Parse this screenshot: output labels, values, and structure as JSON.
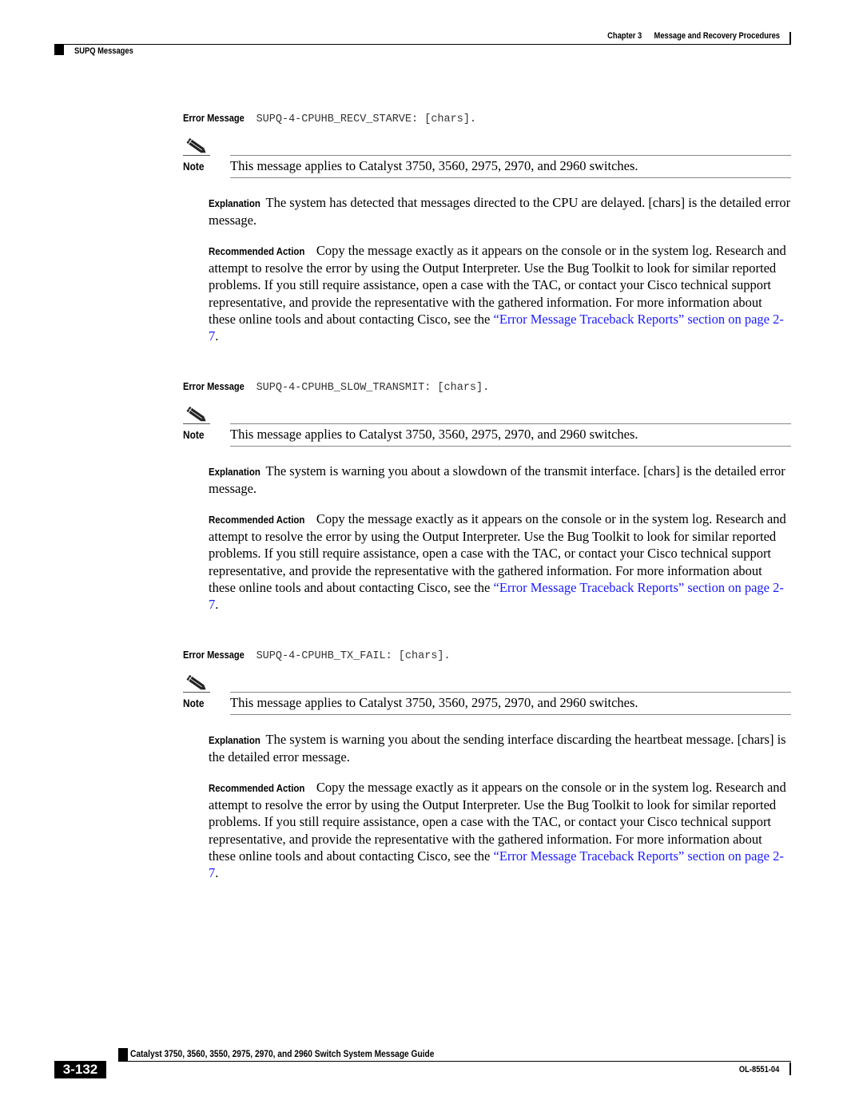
{
  "header": {
    "chapter_label": "Chapter 3",
    "chapter_title": "Message and Recovery Procedures",
    "section": "SUPQ Messages"
  },
  "entries": [
    {
      "error_label": "Error Message",
      "error_code": "SUPQ-4-CPUHB_RECV_STARVE: [chars].",
      "note_label": "Note",
      "note_text": "This message applies to Catalyst 3750, 3560, 2975, 2970, and 2960 switches.",
      "explanation_label": "Explanation",
      "explanation_text": "The system has detected that messages directed to the CPU are delayed. [chars] is the detailed error message.",
      "action_label": "Recommended Action",
      "action_text": "Copy the message exactly as it appears on the console or in the system log. Research and attempt to resolve the error by using the Output Interpreter. Use the Bug Toolkit to look for similar reported problems. If you still require assistance, open a case with the TAC, or contact your Cisco technical support representative, and provide the representative with the gathered information. For more information about these online tools and about contacting Cisco, see the ",
      "action_link": "“Error Message Traceback Reports” section on page 2-7",
      "action_end": "."
    },
    {
      "error_label": "Error Message",
      "error_code": "SUPQ-4-CPUHB_SLOW_TRANSMIT: [chars].",
      "note_label": "Note",
      "note_text": "This message applies to Catalyst 3750, 3560, 2975, 2970, and 2960 switches.",
      "explanation_label": "Explanation",
      "explanation_text": "The system is warning you about a slowdown of the transmit interface. [chars] is the detailed error message.",
      "action_label": "Recommended Action",
      "action_text": "Copy the message exactly as it appears on the console or in the system log. Research and attempt to resolve the error by using the Output Interpreter. Use the Bug Toolkit to look for similar reported problems. If you still require assistance, open a case with the TAC, or contact your Cisco technical support representative, and provide the representative with the gathered information. For more information about these online tools and about contacting Cisco, see the ",
      "action_link": "“Error Message Traceback Reports” section on page 2-7",
      "action_end": "."
    },
    {
      "error_label": "Error Message",
      "error_code": "SUPQ-4-CPUHB_TX_FAIL: [chars].",
      "note_label": "Note",
      "note_text": "This message applies to Catalyst 3750, 3560, 2975, 2970, and 2960 switches.",
      "explanation_label": "Explanation",
      "explanation_text": "The system is warning you about the sending interface discarding the heartbeat message. [chars] is the detailed error message.",
      "action_label": "Recommended Action",
      "action_text": "Copy the message exactly as it appears on the console or in the system log. Research and attempt to resolve the error by using the Output Interpreter. Use the Bug Toolkit to look for similar reported problems. If you still require assistance, open a case with the TAC, or contact your Cisco technical support representative, and provide the representative with the gathered information. For more information about these online tools and about contacting Cisco, see the ",
      "action_link": "“Error Message Traceback Reports” section on page 2-7",
      "action_end": "."
    }
  ],
  "footer": {
    "guide_title": "Catalyst 3750, 3560, 3550, 2975, 2970, and 2960 Switch System Message Guide",
    "page_number": "3-132",
    "doc_number": "OL-8551-04"
  },
  "colors": {
    "link": "#1a1aff"
  }
}
